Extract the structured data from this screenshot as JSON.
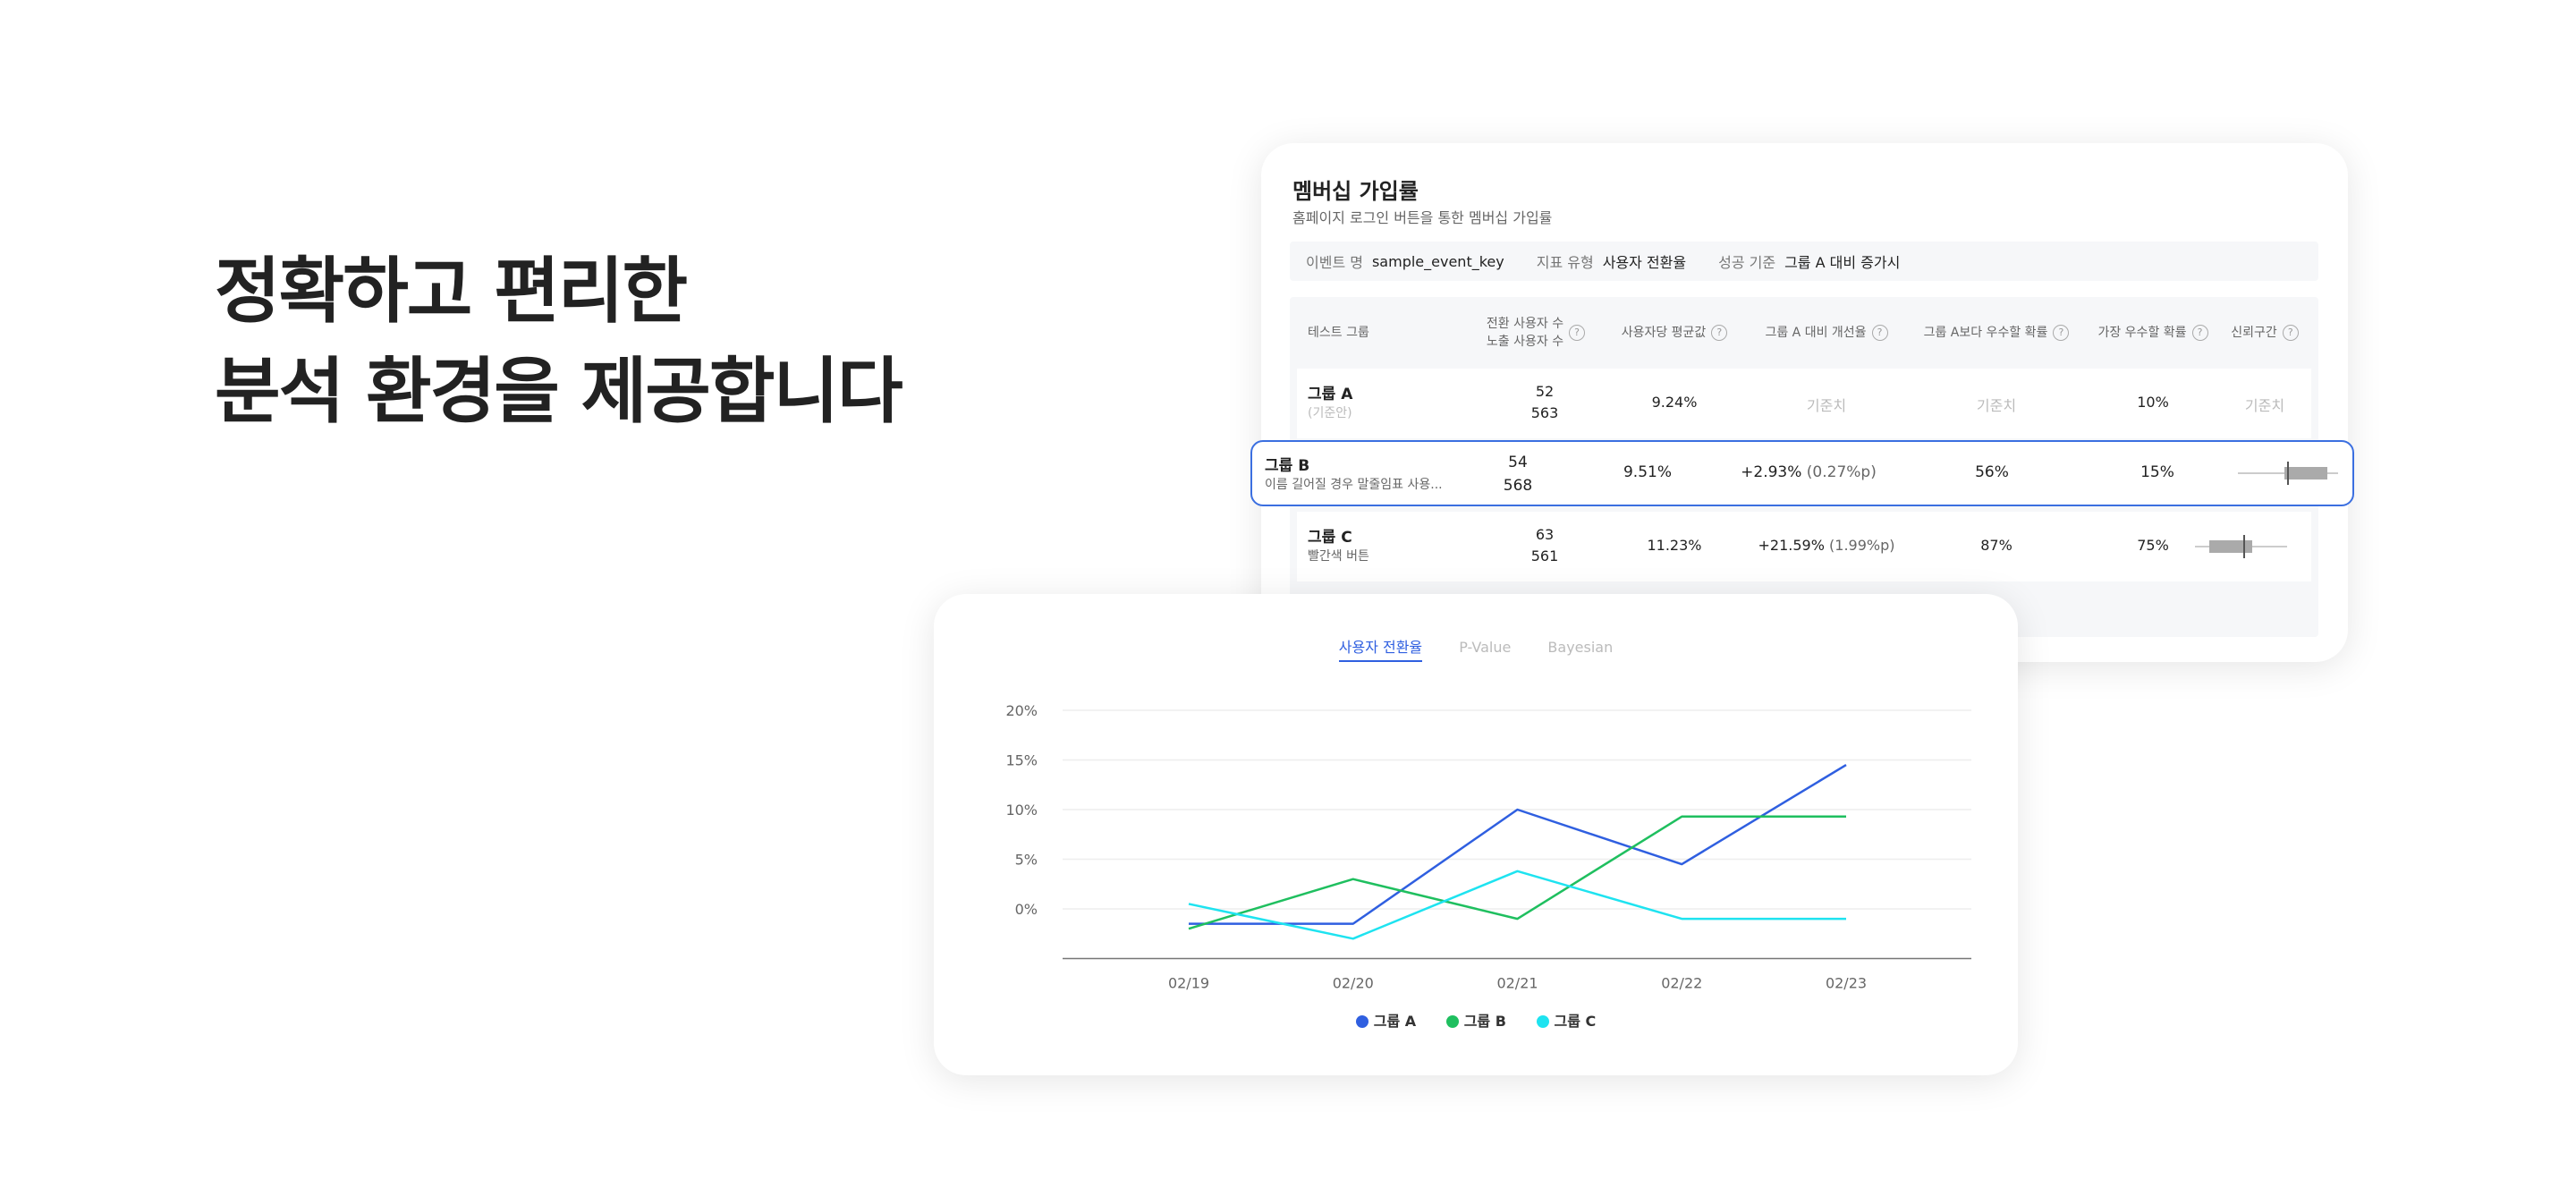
{
  "headline": {
    "line1": "정확하고 편리한",
    "line2": "분석 환경을 제공합니다"
  },
  "table_card": {
    "title": "멤버십 가입률",
    "subtitle": "홈페이지 로그인 버튼을 통한 멤버십 가입률",
    "meta": [
      {
        "key": "이벤트 명",
        "value": "sample_event_key"
      },
      {
        "key": "지표 유형",
        "value": "사용자 전환율"
      },
      {
        "key": "성공 기준",
        "value": "그룹 A 대비 증가시"
      }
    ],
    "headers": {
      "group": "테스트 그룹",
      "users_line1": "전환 사용자 수",
      "users_line2": "노출 사용자 수",
      "avg": "사용자당 평균값",
      "improve": "그룹 A 대비 개선율",
      "better": "그룹 A보다 우수할 확률",
      "best": "가장 우수할 확률",
      "ci": "신뢰구간"
    },
    "rows": [
      {
        "name": "그룹 A",
        "sub": "(기준안)",
        "conv": "52",
        "exposed": "563",
        "avg": "9.24%",
        "improve": "기준치",
        "improve_pp": "",
        "better": "기준치",
        "best": "10%",
        "ci": "기준치"
      },
      {
        "name": "그룹 B",
        "sub": "이름 길어질 경우 말줄임표 사용...",
        "conv": "54",
        "exposed": "568",
        "avg": "9.51%",
        "improve": "+2.93%",
        "improve_pp": "(0.27%p)",
        "better": "56%",
        "best": "15%",
        "ci": ""
      },
      {
        "name": "그룹 C",
        "sub": "빨간색 버튼",
        "conv": "63",
        "exposed": "561",
        "avg": "11.23%",
        "improve": "+21.59%",
        "improve_pp": "(1.99%p)",
        "better": "87%",
        "best": "75%",
        "ci": ""
      }
    ],
    "help_glyph": "?"
  },
  "chart_card": {
    "tabs": [
      "사용자 전환율",
      "P-Value",
      "Bayesian"
    ],
    "active_tab": 0
  },
  "chart_data": {
    "type": "line",
    "categories": [
      "02/19",
      "02/20",
      "02/21",
      "02/22",
      "02/23"
    ],
    "y_ticks": [
      "20%",
      "15%",
      "10%",
      "5%",
      "0%"
    ],
    "ylim": [
      -5,
      20
    ],
    "series": [
      {
        "name": "그룹 A",
        "color": "#2f5fe0",
        "values": [
          -1.5,
          -1.5,
          10,
          4.5,
          14.5
        ]
      },
      {
        "name": "그룹 B",
        "color": "#1fbf5f",
        "values": [
          -2,
          3,
          -1,
          9.3,
          9.3
        ]
      },
      {
        "name": "그룹 C",
        "color": "#1ee3f0",
        "values": [
          0.5,
          -3,
          3.8,
          -1,
          -1
        ]
      }
    ],
    "grid": true,
    "legend": "bottom-center"
  }
}
